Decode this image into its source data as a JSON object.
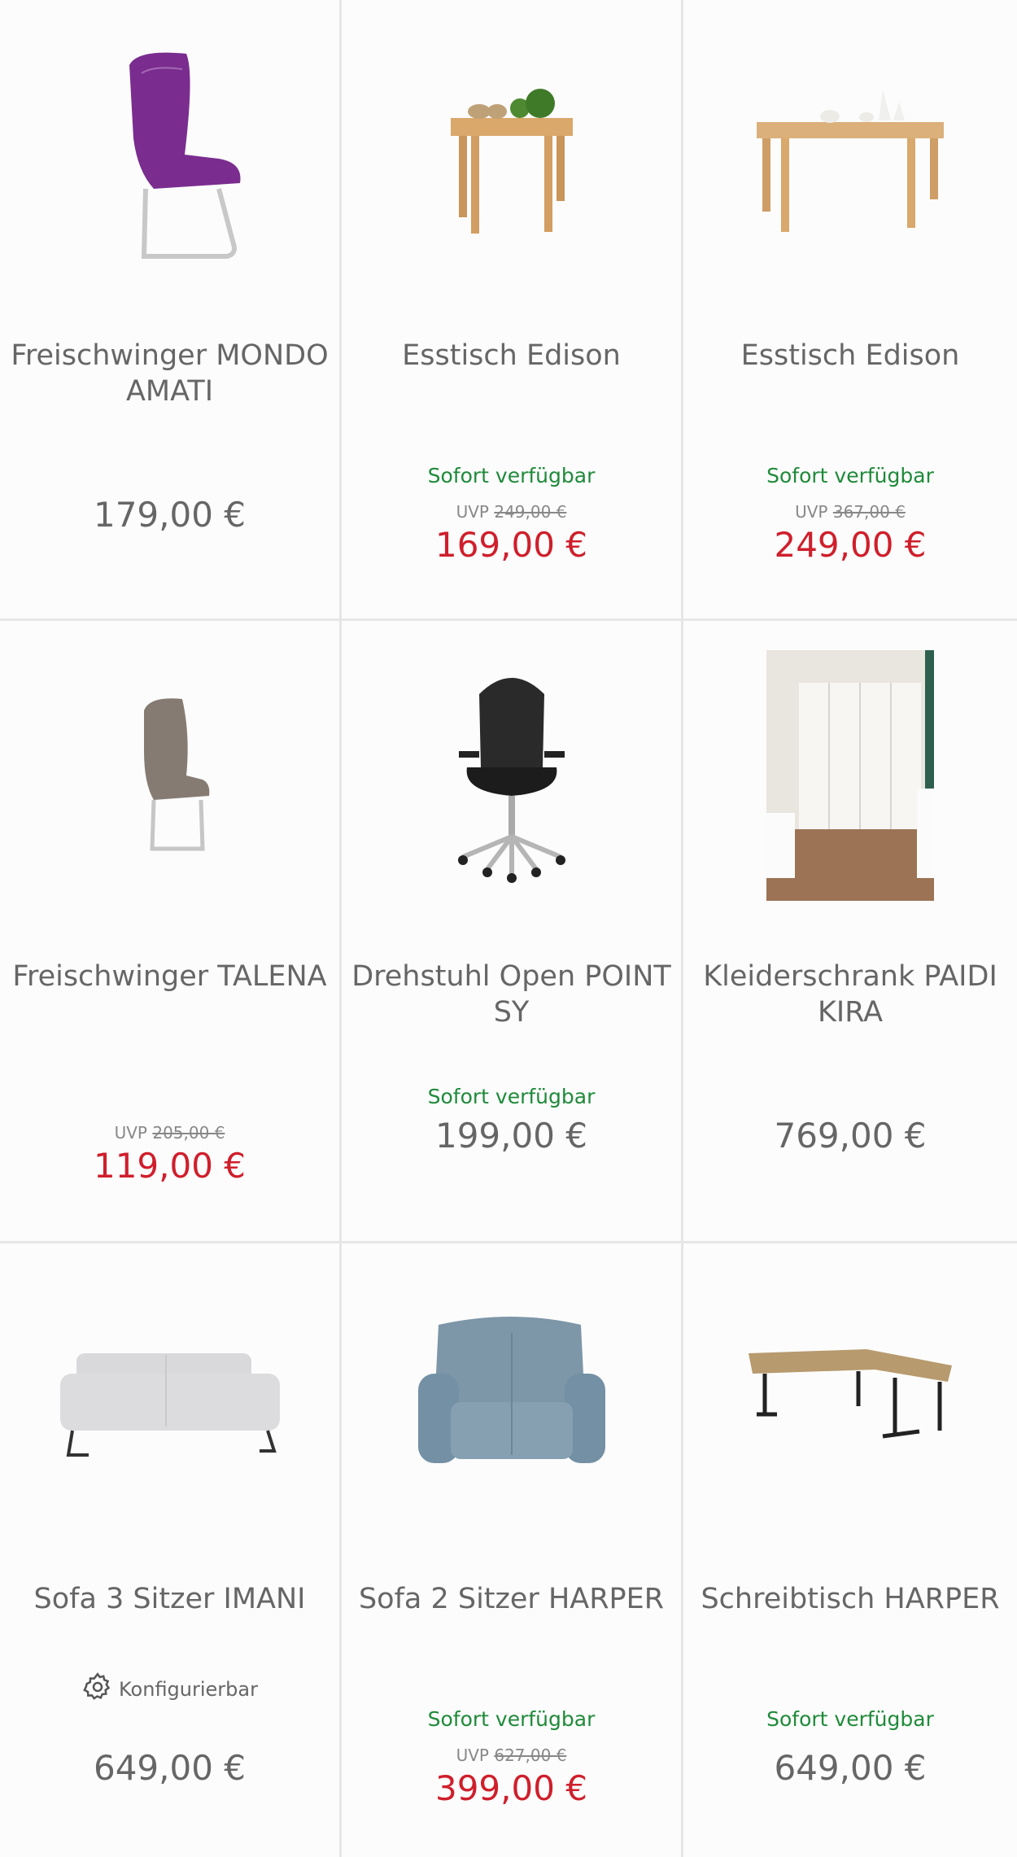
{
  "products": [
    {
      "title": "Freischwinger MONDO AMATI",
      "availability": "",
      "uvp_label": "",
      "uvp_old": "",
      "price": "179,00 €",
      "sale": false,
      "configurable": ""
    },
    {
      "title": "Esstisch Edison",
      "availability": "Sofort verfügbar",
      "uvp_label": "UVP",
      "uvp_old": "249,00 €",
      "price": "169,00 €",
      "sale": true,
      "configurable": ""
    },
    {
      "title": "Esstisch Edison",
      "availability": "Sofort verfügbar",
      "uvp_label": "UVP",
      "uvp_old": "367,00 €",
      "price": "249,00 €",
      "sale": true,
      "configurable": ""
    },
    {
      "title": "Freischwinger TALENA",
      "availability": "",
      "uvp_label": "UVP",
      "uvp_old": "205,00 €",
      "price": "119,00 €",
      "sale": true,
      "configurable": ""
    },
    {
      "title": "Drehstuhl Open POINT SY",
      "availability": "Sofort verfügbar",
      "uvp_label": "",
      "uvp_old": "",
      "price": "199,00 €",
      "sale": false,
      "configurable": ""
    },
    {
      "title": "Kleiderschrank PAIDI KIRA",
      "availability": "",
      "uvp_label": "",
      "uvp_old": "",
      "price": "769,00 €",
      "sale": false,
      "configurable": ""
    },
    {
      "title": "Sofa 3 Sitzer IMANI",
      "availability": "",
      "uvp_label": "",
      "uvp_old": "",
      "price": "649,00 €",
      "sale": false,
      "configurable": "Konfigurierbar"
    },
    {
      "title": "Sofa 2 Sitzer HARPER",
      "availability": "Sofort verfügbar",
      "uvp_label": "UVP",
      "uvp_old": "627,00 €",
      "price": "399,00 €",
      "sale": true,
      "configurable": ""
    },
    {
      "title": "Schreibtisch HARPER",
      "availability": "Sofort verfügbar",
      "uvp_label": "",
      "uvp_old": "",
      "price": "649,00 €",
      "sale": false,
      "configurable": ""
    }
  ],
  "colors": {
    "available": "#1f8a3a",
    "sale_price": "#cf1f2c",
    "regular_price": "#666666"
  },
  "icons": {
    "configurable": "gear-icon"
  }
}
